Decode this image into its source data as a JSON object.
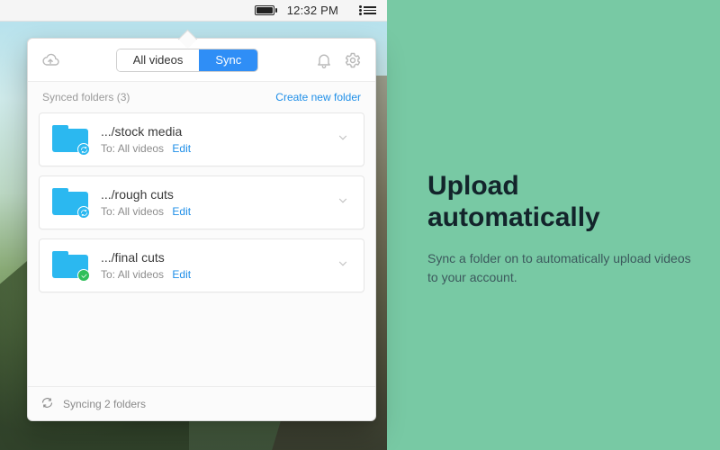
{
  "menubar": {
    "clock": "12:32 PM"
  },
  "panel": {
    "tabs": {
      "all": "All videos",
      "sync": "Sync"
    },
    "sub_heading": "Synced folders (3)",
    "create_link": "Create new folder",
    "to_prefix": "To: ",
    "edit_label": "Edit",
    "footer_status": "Syncing 2 folders",
    "folders": [
      {
        "name": ".../stock media",
        "to": "All videos",
        "state": "sync"
      },
      {
        "name": ".../rough cuts",
        "to": "All videos",
        "state": "sync"
      },
      {
        "name": ".../final cuts",
        "to": "All videos",
        "state": "ok"
      }
    ]
  },
  "marketing": {
    "title": "Upload automatically",
    "body": "Sync a folder on to automatically upload videos to your account."
  }
}
